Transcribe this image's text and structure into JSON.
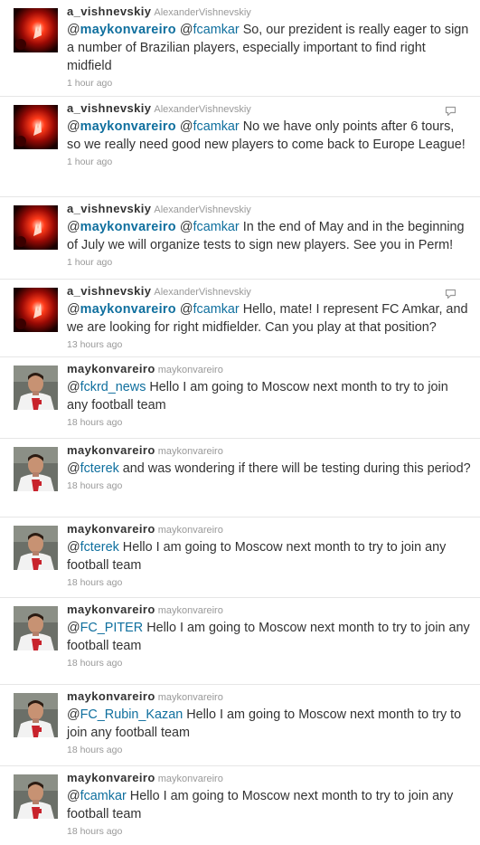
{
  "tweets": [
    {
      "avatar": "vishnevskiy-avatar",
      "screen_name": "a_vishnevskiy",
      "full_name": "AlexanderVishnevskiy",
      "mentions": [
        {
          "at": "@",
          "name": "maykonvareiro",
          "strong": true
        },
        {
          "at": "@",
          "name": "fcamkar",
          "strong": false
        }
      ],
      "text": "So, our prezident is really eager to sign a number of Brazilian players, especially important to find right midfield",
      "time": "1 hour ago",
      "has_reply_icon": false
    },
    {
      "avatar": "vishnevskiy-avatar",
      "screen_name": "a_vishnevskiy",
      "full_name": "AlexanderVishnevskiy",
      "mentions": [
        {
          "at": "@",
          "name": "maykonvareiro",
          "strong": true
        },
        {
          "at": "@",
          "name": "fcamkar",
          "strong": false
        }
      ],
      "text": "No we have only points after 6 tours, so we really need good new players to come back to Europe League!",
      "time": "1 hour ago",
      "has_reply_icon": true
    },
    {
      "avatar": "vishnevskiy-avatar",
      "screen_name": "a_vishnevskiy",
      "full_name": "AlexanderVishnevskiy",
      "mentions": [
        {
          "at": "@",
          "name": "maykonvareiro",
          "strong": true
        },
        {
          "at": "@",
          "name": "fcamkar",
          "strong": false
        }
      ],
      "text": "In the end of May and in the beginning of July we will organize tests to sign new players. See you in Perm!",
      "time": "1 hour ago",
      "has_reply_icon": false
    },
    {
      "avatar": "vishnevskiy-avatar",
      "screen_name": "a_vishnevskiy",
      "full_name": "AlexanderVishnevskiy",
      "mentions": [
        {
          "at": "@",
          "name": "maykonvareiro",
          "strong": true
        },
        {
          "at": "@",
          "name": "fcamkar",
          "strong": false
        }
      ],
      "text": "Hello, mate! I represent FC Amkar, and we are looking for right midfielder. Can you play at that position?",
      "time": "13 hours ago",
      "has_reply_icon": true
    },
    {
      "avatar": "maykon-avatar",
      "screen_name": "maykonvareiro",
      "full_name": "maykonvareiro",
      "mentions": [
        {
          "at": "@",
          "name": "fckrd_news",
          "strong": false
        }
      ],
      "text": "Hello I am going to Moscow next month to try to join any football team",
      "time": "18 hours ago",
      "has_reply_icon": false
    },
    {
      "avatar": "maykon-avatar",
      "screen_name": "maykonvareiro",
      "full_name": "maykonvareiro",
      "mentions": [
        {
          "at": "@",
          "name": "fcterek",
          "strong": false
        }
      ],
      "text": "and was wondering if there will be testing during this period?",
      "time": "18 hours ago",
      "has_reply_icon": false
    },
    {
      "avatar": "maykon-avatar",
      "screen_name": "maykonvareiro",
      "full_name": "maykonvareiro",
      "mentions": [
        {
          "at": "@",
          "name": "fcterek",
          "strong": false
        }
      ],
      "text": "Hello I am going to Moscow next month to try to join any football team",
      "time": "18 hours ago",
      "has_reply_icon": false
    },
    {
      "avatar": "maykon-avatar",
      "screen_name": "maykonvareiro",
      "full_name": "maykonvareiro",
      "mentions": [
        {
          "at": "@",
          "name": "FC_PITER",
          "strong": false
        }
      ],
      "text": "Hello I am going to Moscow next month to try to join any football team",
      "time": "18 hours ago",
      "has_reply_icon": false
    },
    {
      "avatar": "maykon-avatar",
      "screen_name": "maykonvareiro",
      "full_name": "maykonvareiro",
      "mentions": [
        {
          "at": "@",
          "name": "FC_Rubin_Kazan",
          "strong": false
        }
      ],
      "text": "Hello I am going to Moscow next month to try to join any football team",
      "time": "18 hours ago",
      "has_reply_icon": false
    },
    {
      "avatar": "maykon-avatar",
      "screen_name": "maykonvareiro",
      "full_name": "maykonvareiro",
      "mentions": [
        {
          "at": "@",
          "name": "fcamkar",
          "strong": false
        }
      ],
      "text": "Hello I am going to Moscow next month to try to join any football team",
      "time": "18 hours ago",
      "has_reply_icon": false
    }
  ],
  "colors": {
    "link": "#0f6f9e",
    "meta": "#999999",
    "divider": "#e6e6e6"
  }
}
